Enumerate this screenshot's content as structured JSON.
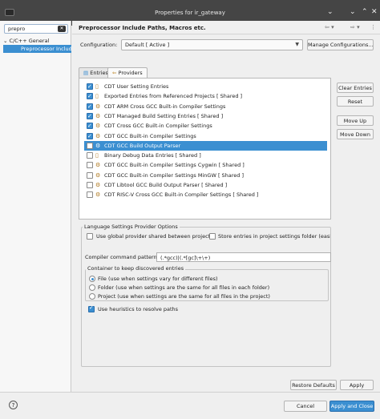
{
  "window": {
    "title": "Properties for ir_gateway"
  },
  "sidebar": {
    "filter_value": "prepro",
    "tree_parent": "C/C++ General",
    "tree_child": "Preprocessor Include"
  },
  "page": {
    "title": "Preprocessor Include Paths, Macros etc.",
    "configuration_label": "Configuration:",
    "configuration_value": "Default  [ Active ]",
    "manage_configs_label": "Manage Configurations..."
  },
  "tabs": {
    "entries": "Entries",
    "providers": "Providers"
  },
  "providers": [
    {
      "label": "CDT User Setting Entries",
      "checked": true,
      "icon": "folder-icon"
    },
    {
      "label": "Exported Entries from Referenced Projects  [ Shared ]",
      "checked": true,
      "icon": "folder-icon"
    },
    {
      "label": "CDT ARM Cross GCC Built-in Compiler Settings",
      "checked": true,
      "icon": "gear-icon"
    },
    {
      "label": "CDT Managed Build Setting Entries  [ Shared ]",
      "checked": true,
      "icon": "gear-icon"
    },
    {
      "label": "CDT Cross GCC Built-in Compiler Settings",
      "checked": true,
      "icon": "gear-icon"
    },
    {
      "label": "CDT GCC Built-in Compiler Settings",
      "checked": true,
      "icon": "gear-icon"
    },
    {
      "label": "CDT GCC Build Output Parser",
      "checked": false,
      "selected": true,
      "icon": "parser-icon"
    },
    {
      "label": "Binary Debug Data Entries  [ Shared ]",
      "checked": false,
      "icon": "document-icon"
    },
    {
      "label": "CDT GCC Built-in Compiler Settings Cygwin  [ Shared ]",
      "checked": false,
      "icon": "gear-icon"
    },
    {
      "label": "CDT GCC Built-in Compiler Settings MinGW  [ Shared ]",
      "checked": false,
      "icon": "gear-icon"
    },
    {
      "label": "CDT Libtool GCC Build Output Parser  [ Shared ]",
      "checked": false,
      "icon": "parser-icon"
    },
    {
      "label": "CDT RISC-V Cross GCC Built-in Compiler Settings  [ Shared ]",
      "checked": false,
      "icon": "gear-icon"
    }
  ],
  "side_buttons": {
    "clear_entries": "Clear Entries",
    "reset": "Reset",
    "move_up": "Move Up",
    "move_down": "Move Down"
  },
  "options": {
    "group_title": "Language Settings Provider Options",
    "use_global": "Use global provider shared between projects",
    "store_entries": "Store entries in project settings folder (easing",
    "compiler_pattern_label": "Compiler command pattern:",
    "compiler_pattern_value": "(.*gcc)|(.*[gc]\\+\\+)",
    "container_title": "Container to keep discovered entries",
    "radio_file": "File (use when settings vary for different files)",
    "radio_folder": "Folder (use when settings are the same for all files in each folder)",
    "radio_project": "Project (use when settings are the same for all files in the project)",
    "heuristics": "Use heuristics to resolve paths"
  },
  "footer": {
    "restore_defaults": "Restore Defaults",
    "apply": "Apply",
    "cancel": "Cancel",
    "apply_and_close": "Apply and Close"
  },
  "colors": {
    "accent": "#3b8fd1",
    "titlebar": "#454545"
  }
}
